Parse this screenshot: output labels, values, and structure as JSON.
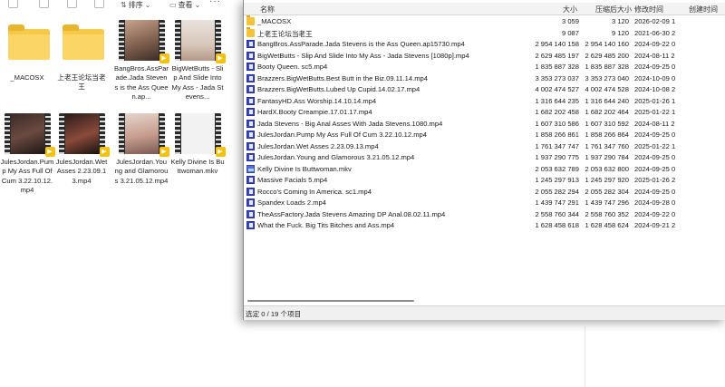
{
  "toolbar": {
    "sort_label": "排序",
    "view_label": "查看",
    "more_label": "···"
  },
  "tiles": [
    {
      "label": "_MACOSX",
      "kind": "folder"
    },
    {
      "label": "上老王论坛当老王",
      "kind": "folder"
    },
    {
      "label": "BangBros.AssParade.Jada Stevens is the Ass Queen.ap...",
      "kind": "video"
    },
    {
      "label": "BigWetButts - Slip And Slide Into My Ass - Jada Stevens...",
      "kind": "video"
    },
    {
      "label": "JulesJordan.Pump My Ass Full Of Cum 3.22.10.12.mp4",
      "kind": "video"
    },
    {
      "label": "JulesJordan.Wet Asses 2.23.09.13.mp4",
      "kind": "video"
    },
    {
      "label": "JulesJordan.Young and Glamorous 3.21.05.12.mp4",
      "kind": "video"
    },
    {
      "label": "Kelly Divine Is Buttwoman.mkv",
      "kind": "video"
    }
  ],
  "archive": {
    "columns": {
      "name": "名称",
      "size": "大小",
      "packed": "压缩后大小",
      "modified": "修改时间",
      "created": "创建时间"
    },
    "files": [
      {
        "name": "_MACOSX",
        "size": "3 059",
        "packed": "3 120",
        "modified": "2026-02-09 1",
        "type": "folder"
      },
      {
        "name": "上老王论坛当老王",
        "size": "9 087",
        "packed": "9 120",
        "modified": "2021-06-30 2",
        "type": "folder"
      },
      {
        "name": "BangBros.AssParade.Jada Stevens is the Ass Queen.ap15730.mp4",
        "size": "2 954 140 158",
        "packed": "2 954 140 160",
        "modified": "2024-09-22 0",
        "type": "video"
      },
      {
        "name": "BigWetButts - Slip And Slide Into My Ass - Jada Stevens [1080p].mp4",
        "size": "2 629 485 197",
        "packed": "2 629 485 200",
        "modified": "2024-08-11 2",
        "type": "video"
      },
      {
        "name": "Booty Queen. sc5.mp4",
        "size": "1 835 887 328",
        "packed": "1 835 887 328",
        "modified": "2024-09-25 0",
        "type": "video"
      },
      {
        "name": "Brazzers.BigWetButts.Best Butt in the Biz.09.11.14.mp4",
        "size": "3 353 273 037",
        "packed": "3 353 273 040",
        "modified": "2024-10-09 0",
        "type": "video"
      },
      {
        "name": "Brazzers.BigWetButts.Lubed Up Cupid.14.02.17.mp4",
        "size": "4 002 474 527",
        "packed": "4 002 474 528",
        "modified": "2024-10-08 2",
        "type": "video"
      },
      {
        "name": "FantasyHD.Ass Worship.14.10.14.mp4",
        "size": "1 316 644 235",
        "packed": "1 316 644 240",
        "modified": "2025-01-26 1",
        "type": "video"
      },
      {
        "name": "HardX.Booty Creampie.17.01.17.mp4",
        "size": "1 682 202 458",
        "packed": "1 682 202 464",
        "modified": "2025-01-22 1",
        "type": "video"
      },
      {
        "name": "Jada Stevens - Big Anal Asses With Jada Stevens.1080.mp4",
        "size": "1 607 310 586",
        "packed": "1 607 310 592",
        "modified": "2024-08-11 2",
        "type": "video"
      },
      {
        "name": "JulesJordan.Pump My Ass Full Of Cum 3.22.10.12.mp4",
        "size": "1 858 266 861",
        "packed": "1 858 266 864",
        "modified": "2024-09-25 0",
        "type": "video"
      },
      {
        "name": "JulesJordan.Wet Asses 2.23.09.13.mp4",
        "size": "1 761 347 747",
        "packed": "1 761 347 760",
        "modified": "2025-01-22 1",
        "type": "video"
      },
      {
        "name": "JulesJordan.Young and Glamorous 3.21.05.12.mp4",
        "size": "1 937 290 775",
        "packed": "1 937 290 784",
        "modified": "2024-09-25 0",
        "type": "video"
      },
      {
        "name": "Kelly Divine Is Buttwoman.mkv",
        "size": "2 053 632 789",
        "packed": "2 053 632 800",
        "modified": "2024-09-25 0",
        "type": "mkv"
      },
      {
        "name": "Massive Facials 5.mp4",
        "size": "1 245 297 913",
        "packed": "1 245 297 920",
        "modified": "2025-01-26 2",
        "type": "video"
      },
      {
        "name": "Rocco's Coming In America. sc1.mp4",
        "size": "2 055 282 294",
        "packed": "2 055 282 304",
        "modified": "2024-09-25 0",
        "type": "video"
      },
      {
        "name": "Spandex Loads 2.mp4",
        "size": "1 439 747 291",
        "packed": "1 439 747 296",
        "modified": "2024-09-28 0",
        "type": "video"
      },
      {
        "name": "TheAssFactory.Jada Stevens Amazing DP Anal.08.02.11.mp4",
        "size": "2 558 760 344",
        "packed": "2 558 760 352",
        "modified": "2024-09-22 0",
        "type": "video"
      },
      {
        "name": "What the Fuck. Big Tits Bitches and Ass.mp4",
        "size": "1 628 458 618",
        "packed": "1 628 458 624",
        "modified": "2024-09-21 2",
        "type": "video"
      }
    ],
    "status": "选定 0 / 19 个项目"
  }
}
